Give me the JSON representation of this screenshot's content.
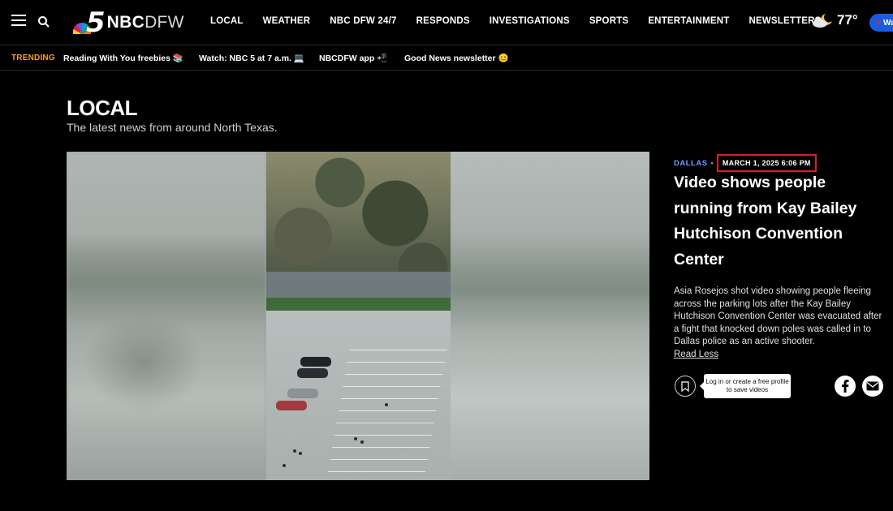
{
  "header": {
    "brand": "NBC",
    "brand_suffix": "DFW",
    "logo_number": "5",
    "nav": [
      "LOCAL",
      "WEATHER",
      "NBC DFW 24/7",
      "RESPONDS",
      "INVESTIGATIONS",
      "SPORTS",
      "ENTERTAINMENT",
      "NEWSLETTERS"
    ],
    "temperature": "77°",
    "watch_label": "Wa"
  },
  "trending": {
    "label": "TRENDING",
    "items": [
      "Reading With You freebies 📚",
      "Watch: NBC 5 at 7 a.m. 💻",
      "NBCDFW app 📲",
      "Good News newsletter 😊"
    ]
  },
  "section": {
    "title": "LOCAL",
    "subtitle": "The latest news from around North Texas."
  },
  "article": {
    "category": "DALLAS",
    "separator": "•",
    "date": "MARCH 1, 2025 6:06 PM",
    "headline": "Video shows people running from Kay Bailey Hutchison Convention Center",
    "description": "Asia Rosejos shot video showing people fleeing across the parking lots after the Kay Bailey Hutchison Convention Center was evacuated after a fight that knocked down poles was called in to Dallas police as an active shooter.",
    "read_less": "Read Less",
    "save_tooltip": "Log in or create a free profile to save videos"
  },
  "colors": {
    "accent_blue": "#6f9bff",
    "trending_orange": "#f4a12c",
    "highlight_red": "#e0192d",
    "watch_button": "#1a5ce0"
  }
}
